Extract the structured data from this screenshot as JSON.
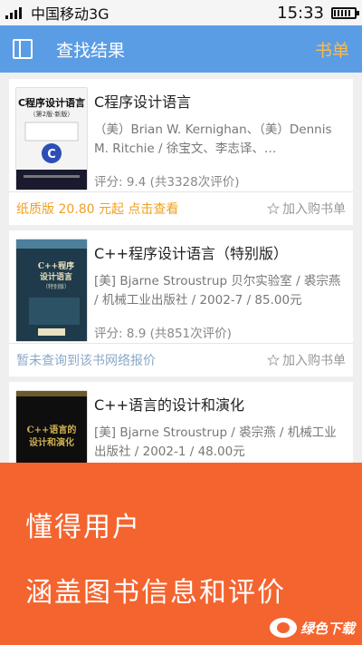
{
  "status_bar": {
    "carrier": "中国移动3G",
    "time": "15:33"
  },
  "app_bar": {
    "title": "查找结果",
    "right_action": "书单"
  },
  "books": [
    {
      "title": "C程序设计语言",
      "meta": "（美）Brian W. Kernighan、（美）Dennis M. Ritchie / 徐宝文、李志译、…",
      "rating": "评分: 9.4 (共3328次评价)",
      "price_text": "纸质版 20.80 元起 点击查看",
      "has_price": true,
      "cart_label": "加入购书单",
      "cover_title": "C程序设计语言",
      "cover_sub": "（第2版·新版）",
      "cover_colors": {
        "bg": "#f2f2f2",
        "band": "#1a1a2e",
        "badge": "#2b4fb6"
      }
    },
    {
      "title": "C++程序设计语言（特别版）",
      "meta": "[美] Bjarne Stroustrup 贝尔实验室 / 裘宗燕 / 机械工业出版社 / 2002-7 / 85.00元",
      "rating": "评分: 8.9 (共851次评价)",
      "price_text": "暂未查询到该书网络报价",
      "has_price": false,
      "cart_label": "加入购书单",
      "cover_title": "C++程序设计语言",
      "cover_sub": "（特别版）",
      "cover_colors": {
        "bg": "#1f3a4a",
        "band": "#4d7f9a",
        "badge": "#e8e2c0"
      }
    },
    {
      "title": "C++语言的设计和演化",
      "meta": "[美] Bjarne Stroustrup / 裘宗燕 / 机械工业出版社 / 2002-1 / 48.00元",
      "cover_title": "C++语言的设计和演化",
      "cover_colors": {
        "bg": "#0e0e0e",
        "band": "#6b5b2a",
        "badge": "#d0b050"
      }
    }
  ],
  "promo": {
    "line1": "懂得用户",
    "line2": "涵盖图书信息和评价",
    "watermark": "绿色下载"
  }
}
